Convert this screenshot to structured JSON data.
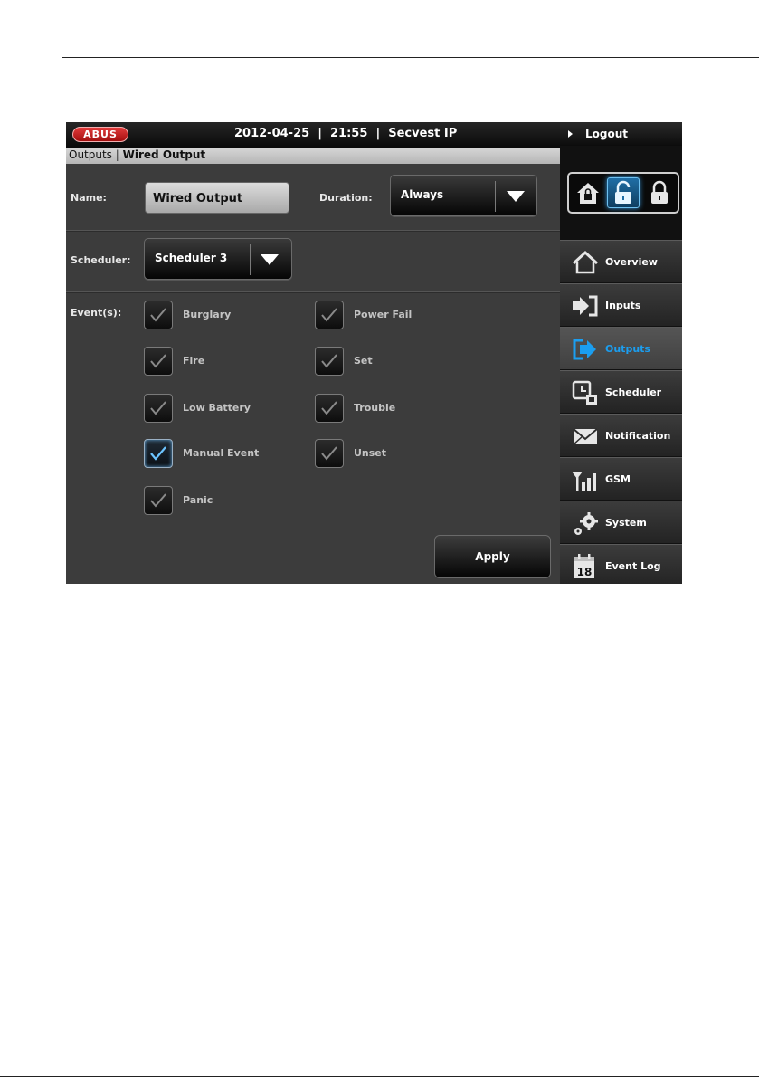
{
  "header": {
    "brand": "ABUS",
    "title": "2012-04-25  |  21:55  |  Secvest IP"
  },
  "breadcrumb": {
    "parent": "Outputs",
    "separator": "|",
    "current": "Wired Output"
  },
  "form": {
    "name_label": "Name:",
    "name_value": "Wired Output",
    "duration_label": "Duration:",
    "duration_value": "Always",
    "scheduler_label": "Scheduler:",
    "scheduler_value": "Scheduler 3",
    "events_label": "Event(s):",
    "events": [
      {
        "label": "Burglary",
        "checked": false
      },
      {
        "label": "Fire",
        "checked": false
      },
      {
        "label": "Low Battery",
        "checked": false
      },
      {
        "label": "Manual Event",
        "checked": true
      },
      {
        "label": "Panic",
        "checked": false
      },
      {
        "label": "Power Fail",
        "checked": false
      },
      {
        "label": "Set",
        "checked": false
      },
      {
        "label": "Trouble",
        "checked": false
      },
      {
        "label": "Unset",
        "checked": false
      }
    ],
    "apply_label": "Apply"
  },
  "sidebar": {
    "logout_label": "Logout",
    "lock_modes": [
      {
        "icon": "home-lock-icon",
        "active": false
      },
      {
        "icon": "unlocked-icon",
        "active": true
      },
      {
        "icon": "locked-icon",
        "active": false
      }
    ],
    "items": [
      {
        "label": "Overview",
        "icon": "home-icon",
        "active": false
      },
      {
        "label": "Inputs",
        "icon": "input-arrow-icon",
        "active": false
      },
      {
        "label": "Outputs",
        "icon": "output-arrow-icon",
        "active": true
      },
      {
        "label": "Scheduler",
        "icon": "scheduler-icon",
        "active": false
      },
      {
        "label": "Notification",
        "icon": "envelope-icon",
        "active": false
      },
      {
        "label": "GSM",
        "icon": "signal-icon",
        "active": false
      },
      {
        "label": "System",
        "icon": "gears-icon",
        "active": false
      },
      {
        "label": "Event Log",
        "icon": "calendar-icon",
        "active": false,
        "calendar_day": "18"
      }
    ]
  },
  "colors": {
    "accent": "#1b9ef0",
    "brand": "#c41a1a"
  }
}
